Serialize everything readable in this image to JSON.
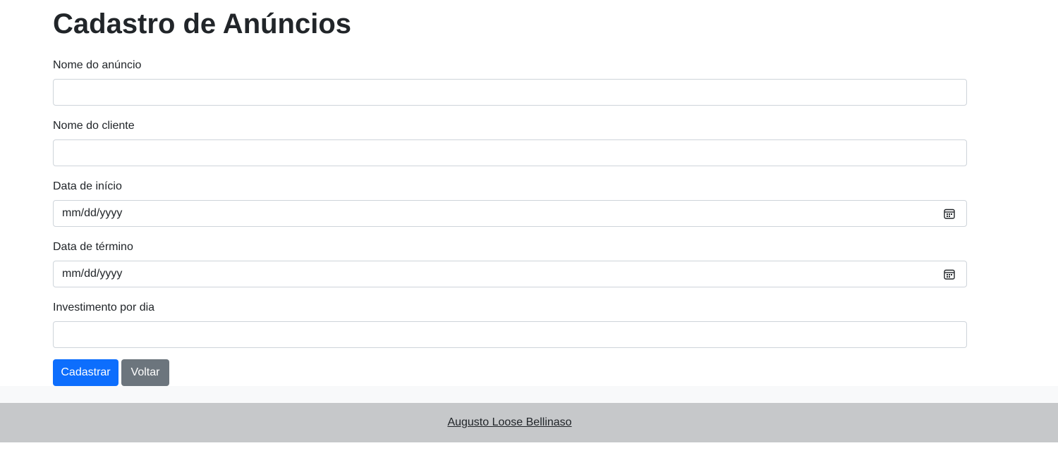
{
  "page": {
    "title": "Cadastro de Anúncios"
  },
  "form": {
    "fields": [
      {
        "label": "Nome do anúncio",
        "value": "",
        "type": "text"
      },
      {
        "label": "Nome do cliente",
        "value": "",
        "type": "text"
      },
      {
        "label": "Data de início",
        "value": "mm/dd/yyyy",
        "type": "date"
      },
      {
        "label": "Data de término",
        "value": "mm/dd/yyyy",
        "type": "date"
      },
      {
        "label": "Investimento por dia",
        "value": "",
        "type": "text"
      }
    ],
    "submit_label": "Cadastrar",
    "back_label": "Voltar"
  },
  "footer": {
    "author_link": "Augusto Loose Bellinaso"
  },
  "colors": {
    "primary": "#0d6efd",
    "secondary": "#6c757d",
    "footer_bg": "#c6c8ca"
  },
  "icons": {
    "date_picker": "calendar-icon"
  }
}
